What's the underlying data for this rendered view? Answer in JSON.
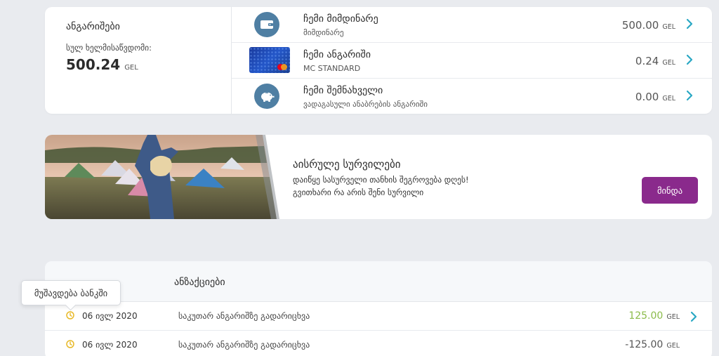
{
  "accounts": {
    "title": "ანგარიშები",
    "available_label": "სულ ხელმისაწვდომი:",
    "total_value": "500.24",
    "total_currency": "GEL",
    "items": [
      {
        "name": "ჩემი მიმდინარე",
        "desc": "მიმდინარე",
        "amount": "500.00",
        "currency": "GEL",
        "icon": "wallet-icon"
      },
      {
        "name": "ჩემი ანგარიში",
        "desc": "MC STANDARD",
        "amount": "0.24",
        "currency": "GEL",
        "icon": "mastercard-card-image"
      },
      {
        "name": "ჩემი შემნახველი",
        "desc": "ვადაგასული ანაბრების ანგარიში",
        "amount": "0.00",
        "currency": "GEL",
        "icon": "piggy-bank-icon"
      }
    ]
  },
  "banner": {
    "title": "აისრულე სურვილები",
    "text_line1": "დაიწყე სასურველი თანხის შეგროვება დღეს!",
    "text_line2": "გვითხარი რა არის შენი სურვილი",
    "button_label": "მინდა"
  },
  "transactions": {
    "title_visible": "ანზაქციები",
    "tooltip": "მუშავდება ბანკში",
    "rows": [
      {
        "date": "06 ივლ 2020",
        "desc": "საკუთარ ანგარიშზე გადარიცხვა",
        "amount": "125.00",
        "currency": "GEL"
      },
      {
        "date": "06 ივლ 2020",
        "desc": "საკუთარ ანგარიშზე გადარიცხვა",
        "amount": "-125.00",
        "currency": "GEL"
      }
    ]
  },
  "colors": {
    "accent_blue": "#2aa8c4",
    "icon_blue": "#4f7fa3",
    "button_purple": "#8a2a8c",
    "positive_green": "#8bbb4a",
    "pending_yellow": "#e8b927"
  }
}
